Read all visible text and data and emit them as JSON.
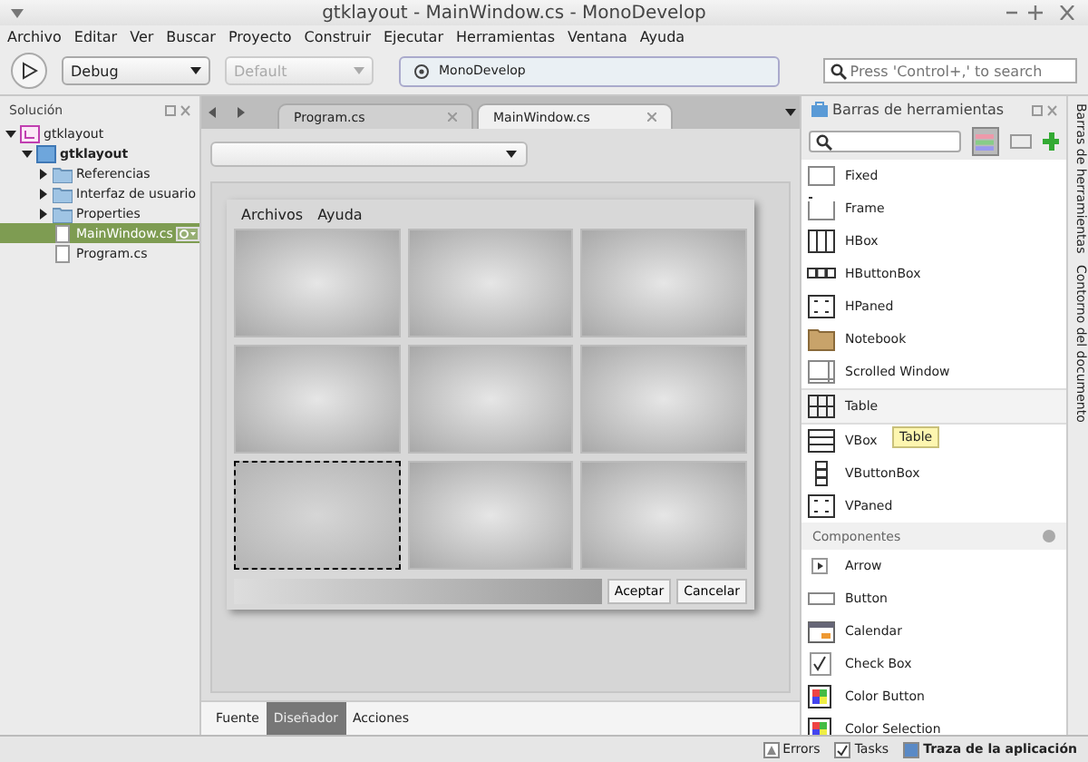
{
  "window": {
    "title": "gtklayout - MainWindow.cs - MonoDevelop"
  },
  "menu": [
    "Archivo",
    "Editar",
    "Ver",
    "Buscar",
    "Proyecto",
    "Construir",
    "Ejecutar",
    "Herramientas",
    "Ventana",
    "Ayuda"
  ],
  "toolbar": {
    "configuration": "Debug",
    "platform": "Default",
    "platform_disabled": true,
    "status": "MonoDevelop",
    "search": {
      "placeholder": "Press 'Control+,' to search"
    }
  },
  "solution": {
    "title": "Solución",
    "tree": [
      {
        "label": "gtklayout",
        "kind": "solution",
        "bold": false,
        "selected": false,
        "expanded": true,
        "children": [
          {
            "label": "gtklayout",
            "kind": "project",
            "bold": true,
            "selected": false,
            "expanded": true,
            "children": [
              {
                "label": "Referencias",
                "kind": "folder",
                "bold": false,
                "selected": false,
                "expanded": false
              },
              {
                "label": "Interfaz de usuario",
                "kind": "folder",
                "bold": false,
                "selected": false,
                "expanded": false
              },
              {
                "label": "Properties",
                "kind": "folder",
                "bold": false,
                "selected": false,
                "expanded": false
              },
              {
                "label": "MainWindow.cs",
                "kind": "file",
                "bold": false,
                "selected": true
              },
              {
                "label": "Program.cs",
                "kind": "file",
                "bold": false,
                "selected": false
              }
            ]
          }
        ]
      }
    ]
  },
  "editor_tabs": [
    {
      "label": "Program.cs",
      "selected": false
    },
    {
      "label": "MainWindow.cs",
      "selected": true
    }
  ],
  "designer": {
    "menu": [
      "Archivos",
      "Ayuda"
    ],
    "cells": [
      {
        "selected": false
      },
      {
        "selected": false
      },
      {
        "selected": false
      },
      {
        "selected": false
      },
      {
        "selected": false
      },
      {
        "selected": false
      },
      {
        "selected": true
      },
      {
        "selected": false
      },
      {
        "selected": false
      }
    ],
    "buttons": [
      "Aceptar",
      "Cancelar"
    ]
  },
  "view_tabs": [
    {
      "label": "Fuente",
      "selected": false
    },
    {
      "label": "Diseñador",
      "selected": true
    },
    {
      "label": "Acciones",
      "selected": false
    }
  ],
  "toolbox": {
    "title": "Barras de herramientas",
    "items": [
      {
        "label": "Fixed",
        "kind": "fixed",
        "selected": false
      },
      {
        "label": "Frame",
        "kind": "frame",
        "selected": false
      },
      {
        "label": "HBox",
        "kind": "hbox",
        "selected": false
      },
      {
        "label": "HButtonBox",
        "kind": "hbuttonbox",
        "selected": false
      },
      {
        "label": "HPaned",
        "kind": "paned",
        "selected": false
      },
      {
        "label": "Notebook",
        "kind": "notebook",
        "selected": false
      },
      {
        "label": "Scrolled Window",
        "kind": "scrolled",
        "selected": false
      },
      {
        "label": "Table",
        "kind": "table",
        "selected": true
      },
      {
        "label": "VBox",
        "kind": "vbox",
        "selected": false
      },
      {
        "label": "VButtonBox",
        "kind": "vbuttonbox",
        "selected": false
      },
      {
        "label": "VPaned",
        "kind": "paned",
        "selected": false
      }
    ],
    "tooltip": "Table",
    "section": "Componentes",
    "components": [
      {
        "label": "Arrow",
        "kind": "arrow"
      },
      {
        "label": "Button",
        "kind": "button"
      },
      {
        "label": "Calendar",
        "kind": "calendar"
      },
      {
        "label": "Check Box",
        "kind": "check"
      },
      {
        "label": "Color Button",
        "kind": "color"
      },
      {
        "label": "Color Selection",
        "kind": "color"
      }
    ]
  },
  "side_tabs": [
    "Barras de herramientas",
    "Contorno del documento"
  ],
  "status_bar": [
    {
      "label": "Errors",
      "kind": "errors",
      "selected": false
    },
    {
      "label": "Tasks",
      "kind": "tasks",
      "selected": false
    },
    {
      "label": "Traza de la aplicación",
      "kind": "log",
      "selected": true
    }
  ]
}
